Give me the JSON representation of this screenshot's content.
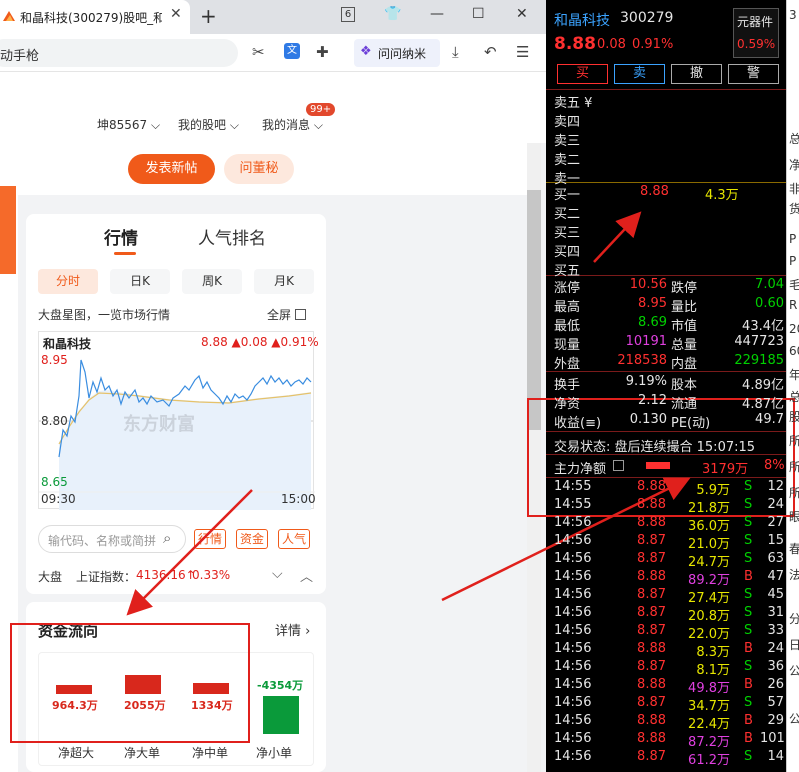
{
  "browser": {
    "tab_title": "和晶科技(300279)股吧_和",
    "tab_count": "6",
    "address_text": "动手枪",
    "wenwen_label": "问问纳米"
  },
  "guba": {
    "nav": {
      "user": "坤85567",
      "my_bar": "我的股吧",
      "my_msg": "我的消息",
      "badge": "99+"
    },
    "post_button": "发表新帖",
    "ask_button": "问董秘"
  },
  "quote_card": {
    "tabs": [
      "行情",
      "人气排名"
    ],
    "period_tabs": [
      "分时",
      "日K",
      "周K",
      "月K"
    ],
    "subtitle": "大盘星图，一览市场行情",
    "fullscreen": "全屏",
    "stock_name": "和晶科技",
    "stock_quote": "8.88 ▲0.08 ▲0.91%",
    "y_high": "8.95",
    "y_mid": "8.80",
    "y_low": "8.65",
    "t_start": "09:30",
    "t_end": "15:00",
    "watermark": "东方财富",
    "search_placeholder": "输代码、名称或简拼",
    "chips": [
      "行情",
      "资金",
      "人气"
    ],
    "index_label": "大盘",
    "index_name": "上证指数：",
    "index_value": "4136.16↑",
    "index_change": "0.33%"
  },
  "flow_card": {
    "title": "资金流向",
    "detail": "详情",
    "items": [
      {
        "value": "964.3万",
        "label": "净超大"
      },
      {
        "value": "2055万",
        "label": "净大单"
      },
      {
        "value": "1334万",
        "label": "净中单"
      },
      {
        "value": "-4354万",
        "label": "净小单"
      }
    ]
  },
  "terminal": {
    "name": "和晶科技",
    "code": "300279",
    "sector": "元器件",
    "sector_pct": "0.59%",
    "price": "8.88",
    "change": "0.08",
    "change_pct": "0.91%",
    "buttons": [
      "买",
      "卖",
      "撤",
      "警"
    ],
    "asks": [
      "卖五 ¥",
      "卖四",
      "卖三",
      "卖二",
      "卖一"
    ],
    "bids": [
      {
        "label": "买一",
        "price": "8.88",
        "vol": "4.3万"
      },
      {
        "label": "买二",
        "price": "",
        "vol": ""
      },
      {
        "label": "买三",
        "price": "",
        "vol": ""
      },
      {
        "label": "买四",
        "price": "",
        "vol": ""
      },
      {
        "label": "买五",
        "price": "",
        "vol": ""
      }
    ],
    "stats": [
      {
        "l1": "涨停",
        "v1": "10.56",
        "l2": "跌停",
        "v2": "7.04"
      },
      {
        "l1": "最高",
        "v1": "8.95",
        "l2": "量比",
        "v2": "0.60"
      },
      {
        "l1": "最低",
        "v1": "8.69",
        "l2": "市值",
        "v2": "43.4亿"
      },
      {
        "l1": "现量",
        "v1": "10191",
        "l2": "总量",
        "v2": "447723"
      },
      {
        "l1": "外盘",
        "v1": "218538",
        "l2": "内盘",
        "v2": "229185"
      }
    ],
    "stats2": [
      {
        "l1": "换手",
        "v1": "9.19%",
        "l2": "股本",
        "v2": "4.89亿"
      },
      {
        "l1": "净资",
        "v1": "2.12",
        "l2": "流通",
        "v2": "4.87亿"
      },
      {
        "l1": "收益(≡)",
        "v1": "0.130",
        "l2": "PE(动)",
        "v2": "49.7"
      }
    ],
    "trade_status": "交易状态: 盘后连续撮合 15:07:15",
    "main_flow_label": "主力净额",
    "main_flow_value": "3179万",
    "main_flow_pct": "8%",
    "ticks": [
      {
        "t": "14:55",
        "p": "8.88",
        "v": "5.9万",
        "d": "S",
        "n": "12"
      },
      {
        "t": "14:55",
        "p": "8.88",
        "v": "21.8万",
        "d": "S",
        "n": "24"
      },
      {
        "t": "14:56",
        "p": "8.88",
        "v": "36.0万",
        "d": "S",
        "n": "27"
      },
      {
        "t": "14:56",
        "p": "8.87",
        "v": "21.0万",
        "d": "S",
        "n": "15"
      },
      {
        "t": "14:56",
        "p": "8.87",
        "v": "24.7万",
        "d": "S",
        "n": "63"
      },
      {
        "t": "14:56",
        "p": "8.88",
        "v": "89.2万",
        "d": "B",
        "n": "47"
      },
      {
        "t": "14:56",
        "p": "8.87",
        "v": "27.4万",
        "d": "S",
        "n": "45"
      },
      {
        "t": "14:56",
        "p": "8.87",
        "v": "20.8万",
        "d": "S",
        "n": "31"
      },
      {
        "t": "14:56",
        "p": "8.87",
        "v": "22.0万",
        "d": "S",
        "n": "33"
      },
      {
        "t": "14:56",
        "p": "8.88",
        "v": "8.3万",
        "d": "B",
        "n": "24"
      },
      {
        "t": "14:56",
        "p": "8.87",
        "v": "8.1万",
        "d": "S",
        "n": "36"
      },
      {
        "t": "14:56",
        "p": "8.88",
        "v": "49.8万",
        "d": "B",
        "n": "26"
      },
      {
        "t": "14:56",
        "p": "8.87",
        "v": "34.7万",
        "d": "S",
        "n": "57"
      },
      {
        "t": "14:56",
        "p": "8.88",
        "v": "22.4万",
        "d": "B",
        "n": "29"
      },
      {
        "t": "14:56",
        "p": "8.88",
        "v": "87.2万",
        "d": "B",
        "n": "101"
      },
      {
        "t": "14:56",
        "p": "8.87",
        "v": "61.2万",
        "d": "S",
        "n": "14"
      }
    ],
    "side_chars": [
      "3",
      "总",
      "净",
      "非",
      "货",
      "P",
      "P",
      "毛",
      "R",
      "20",
      "60",
      "年",
      "总",
      "股",
      "所",
      "所",
      "所",
      "眼",
      "春",
      "法",
      "分",
      "日",
      "公",
      "公"
    ]
  },
  "colors": {
    "accent": "#f05a1a",
    "up": "#ff3030",
    "down": "#00d000",
    "annotation": "#e0201c"
  }
}
